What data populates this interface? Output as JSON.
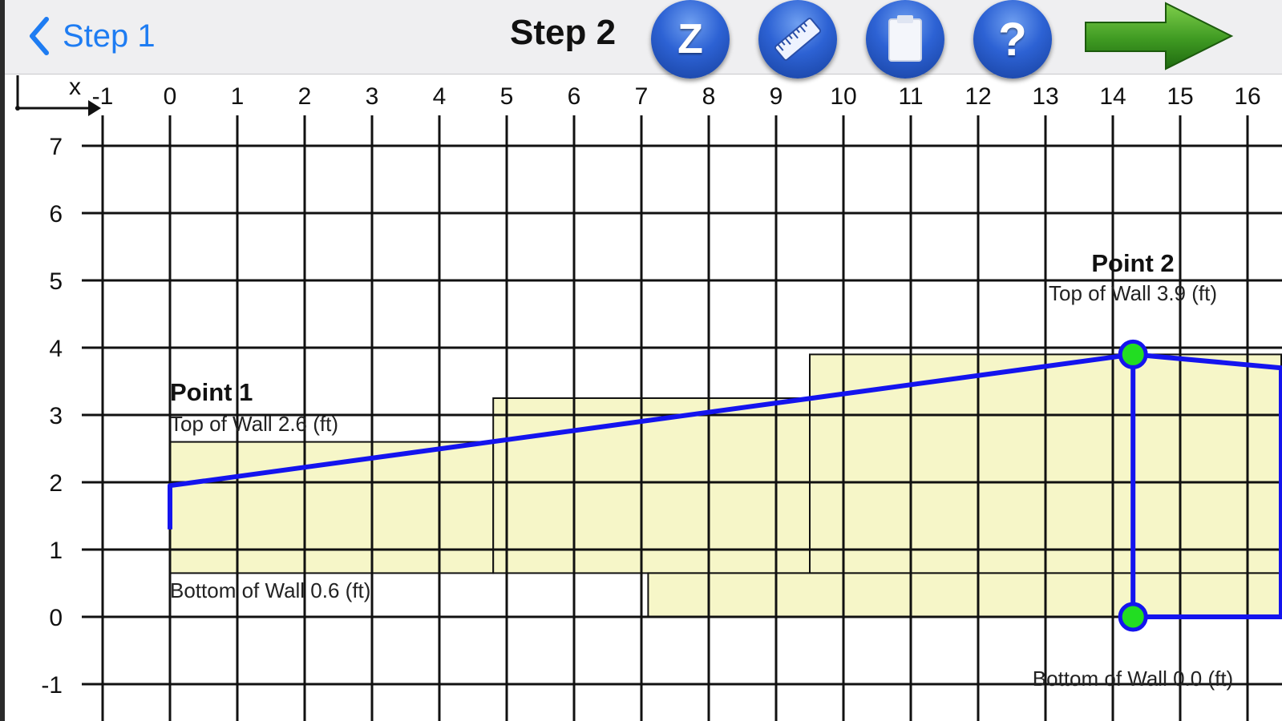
{
  "nav": {
    "back_label": "Step 1",
    "title": "Step 2",
    "zoom_label": "Z",
    "help_label": "?"
  },
  "axis": {
    "corner_label": "x"
  },
  "chart_data": {
    "type": "line",
    "x_ticks": [
      "-1",
      "0",
      "1",
      "2",
      "3",
      "4",
      "5",
      "6",
      "7",
      "8",
      "9",
      "10",
      "11",
      "12",
      "13",
      "14",
      "15",
      "16"
    ],
    "y_ticks": [
      "7",
      "6",
      "5",
      "4",
      "3",
      "2",
      "1",
      "0",
      "-1"
    ],
    "xlim": [
      -1,
      16.5
    ],
    "ylim": [
      -1.6,
      7.5
    ],
    "grid": true,
    "wall_polygon": [
      [
        0,
        1.3
      ],
      [
        0,
        1.95
      ],
      [
        14.3,
        3.9
      ],
      [
        16.5,
        3.7
      ],
      [
        16.5,
        0
      ],
      [
        14.3,
        0
      ]
    ],
    "interior_vertical": [
      [
        14.3,
        0
      ],
      [
        14.3,
        3.9
      ]
    ],
    "fill_steps": [
      {
        "x0": 0.0,
        "x1": 4.8,
        "y0": 0.65,
        "y1": 2.6
      },
      {
        "x0": 4.8,
        "x1": 9.5,
        "y0": 0.65,
        "y1": 3.25
      },
      {
        "x0": 9.5,
        "x1": 16.5,
        "y0": 0.65,
        "y1": 3.9
      },
      {
        "x0": 7.1,
        "x1": 16.5,
        "y0": 0.0,
        "y1": 0.65
      }
    ],
    "points": [
      {
        "x": 14.3,
        "y": 3.9
      },
      {
        "x": 14.3,
        "y": 0.0
      }
    ],
    "annotations": [
      {
        "title": "Point 1",
        "top_label": "Top of Wall 2.6 (ft)",
        "bottom_label": "Bottom of Wall 0.6 (ft)"
      },
      {
        "title": "Point 2",
        "top_label": "Top of Wall 3.9 (ft)",
        "bottom_label": "Bottom of Wall 0.0 (ft)"
      }
    ]
  },
  "colors": {
    "wall_line": "#1414ee",
    "fill": "#f6f6c8",
    "point": "#22dd22",
    "grid": "#111111",
    "accent": "#1e7cf2"
  }
}
